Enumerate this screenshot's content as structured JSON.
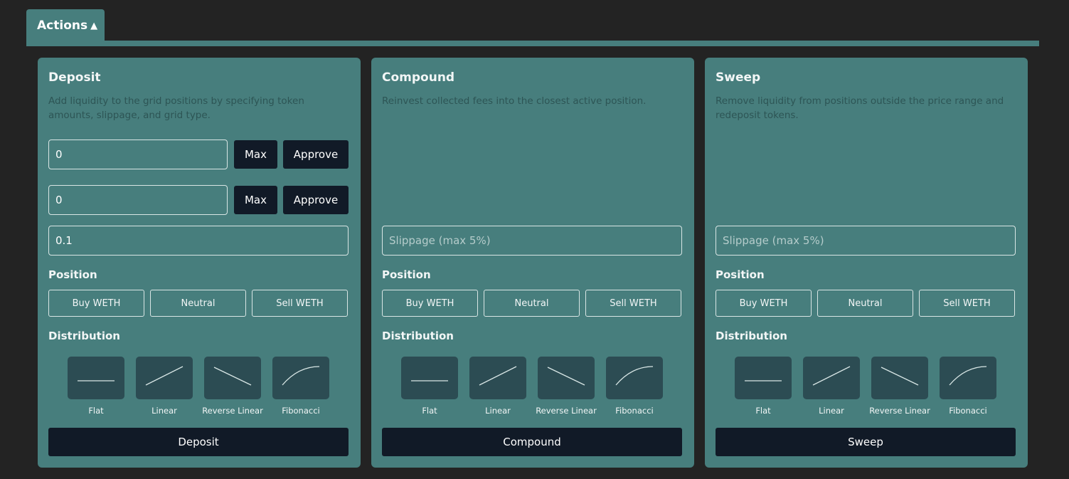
{
  "tab": {
    "label": "Actions",
    "caret": "▲"
  },
  "cards": [
    {
      "title": "Deposit",
      "description": "Add liquidity to the grid positions by specifying token amounts, slippage, and grid type.",
      "token_inputs": [
        {
          "value": "0",
          "max_label": "Max",
          "approve_label": "Approve"
        },
        {
          "value": "0",
          "max_label": "Max",
          "approve_label": "Approve"
        }
      ],
      "slippage": {
        "value": "0.1",
        "placeholder": "Slippage (max 5%)"
      },
      "position_label": "Position",
      "positions": [
        "Buy WETH",
        "Neutral",
        "Sell WETH"
      ],
      "distribution_label": "Distribution",
      "distributions": [
        {
          "icon": "flat-line-icon",
          "label": "Flat"
        },
        {
          "icon": "linear-line-icon",
          "label": "Linear"
        },
        {
          "icon": "reverse-linear-line-icon",
          "label": "Reverse Linear"
        },
        {
          "icon": "fibonacci-curve-icon",
          "label": "Fibonacci"
        }
      ],
      "submit_label": "Deposit"
    },
    {
      "title": "Compound",
      "description": "Reinvest collected fees into the closest active position.",
      "slippage": {
        "value": "",
        "placeholder": "Slippage (max 5%)"
      },
      "position_label": "Position",
      "positions": [
        "Buy WETH",
        "Neutral",
        "Sell WETH"
      ],
      "distribution_label": "Distribution",
      "distributions": [
        {
          "icon": "flat-line-icon",
          "label": "Flat"
        },
        {
          "icon": "linear-line-icon",
          "label": "Linear"
        },
        {
          "icon": "reverse-linear-line-icon",
          "label": "Reverse Linear"
        },
        {
          "icon": "fibonacci-curve-icon",
          "label": "Fibonacci"
        }
      ],
      "submit_label": "Compound"
    },
    {
      "title": "Sweep",
      "description": "Remove liquidity from positions outside the price range and redeposit tokens.",
      "slippage": {
        "value": "",
        "placeholder": "Slippage (max 5%)"
      },
      "position_label": "Position",
      "positions": [
        "Buy WETH",
        "Neutral",
        "Sell WETH"
      ],
      "distribution_label": "Distribution",
      "distributions": [
        {
          "icon": "flat-line-icon",
          "label": "Flat"
        },
        {
          "icon": "linear-line-icon",
          "label": "Linear"
        },
        {
          "icon": "reverse-linear-line-icon",
          "label": "Reverse Linear"
        },
        {
          "icon": "fibonacci-curve-icon",
          "label": "Fibonacci"
        }
      ],
      "submit_label": "Sweep"
    }
  ],
  "colors": {
    "background": "#232323",
    "panel": "#477e7d",
    "dark_button": "#111a27",
    "icon_box": "#2c4c53"
  }
}
